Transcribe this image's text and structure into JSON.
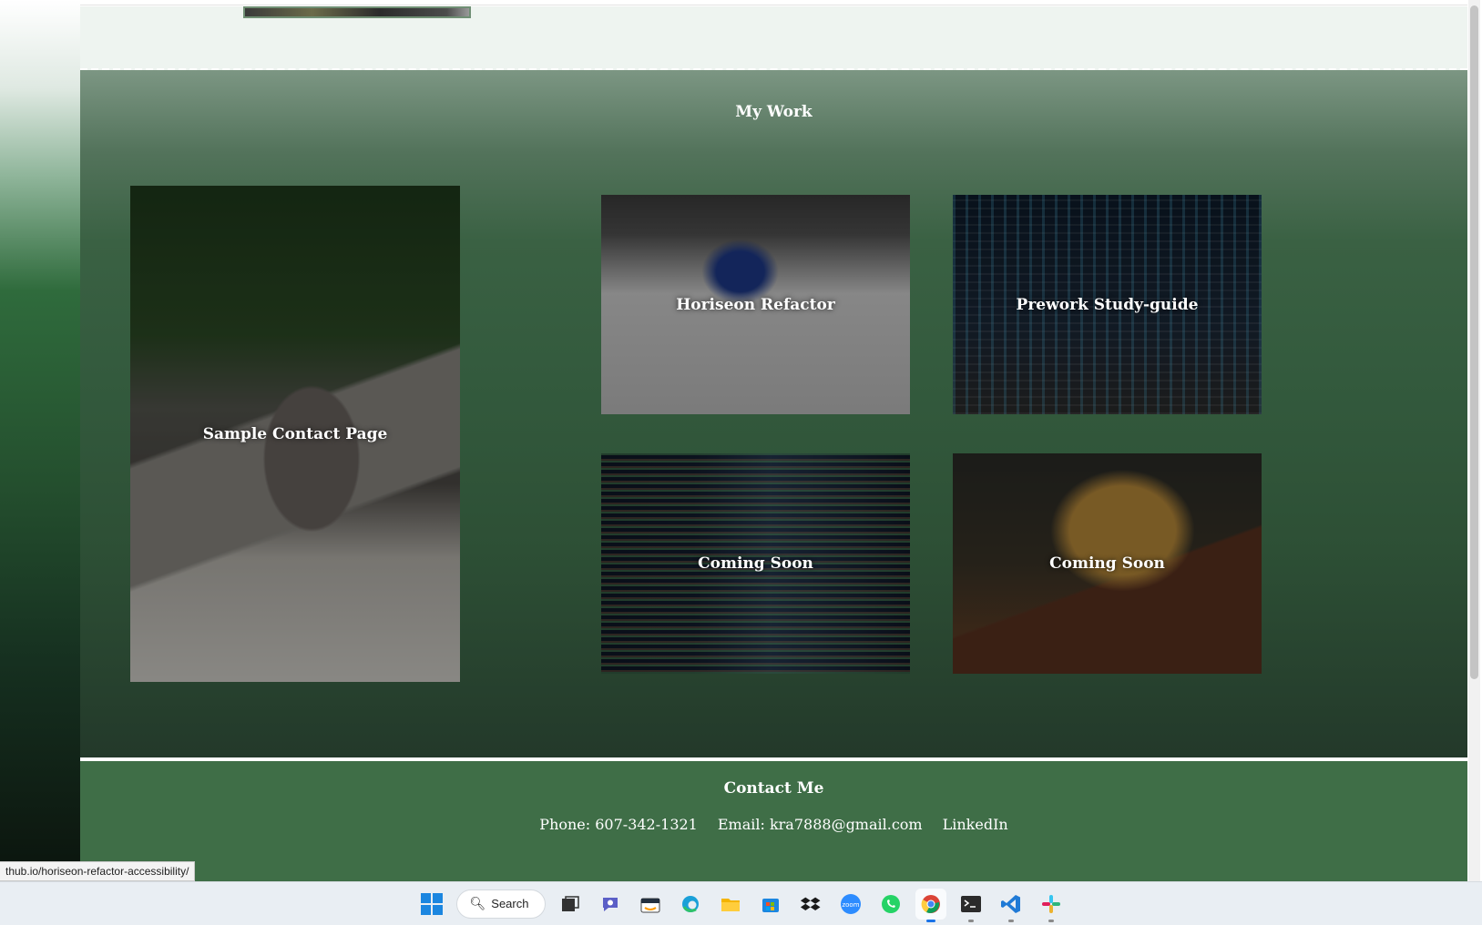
{
  "work": {
    "title": "My Work",
    "cards": [
      {
        "label": "Sample Contact Page"
      },
      {
        "label": "Horiseon Refactor"
      },
      {
        "label": "Prework Study-guide"
      },
      {
        "label": "Coming Soon"
      },
      {
        "label": "Coming Soon"
      }
    ]
  },
  "contact": {
    "title": "Contact Me",
    "phone": "Phone: 607-342-1321",
    "email": "Email: kra7888@gmail.com",
    "linkedin": "LinkedIn"
  },
  "status_url": "thub.io/horiseon-refactor-accessibility/",
  "taskbar": {
    "search_label": "Search",
    "icons": [
      "windows-start-icon",
      "search-icon",
      "task-view-icon",
      "teams-chat-icon",
      "amazon-icon",
      "edge-icon",
      "file-explorer-icon",
      "microsoft-store-icon",
      "dropbox-icon",
      "zoom-icon",
      "whatsapp-icon",
      "chrome-icon",
      "terminal-icon",
      "vscode-icon",
      "slack-icon"
    ]
  },
  "colors": {
    "section_green": "#3f6e47",
    "header_bg": "#eef4f0",
    "text": "#ffffff"
  }
}
